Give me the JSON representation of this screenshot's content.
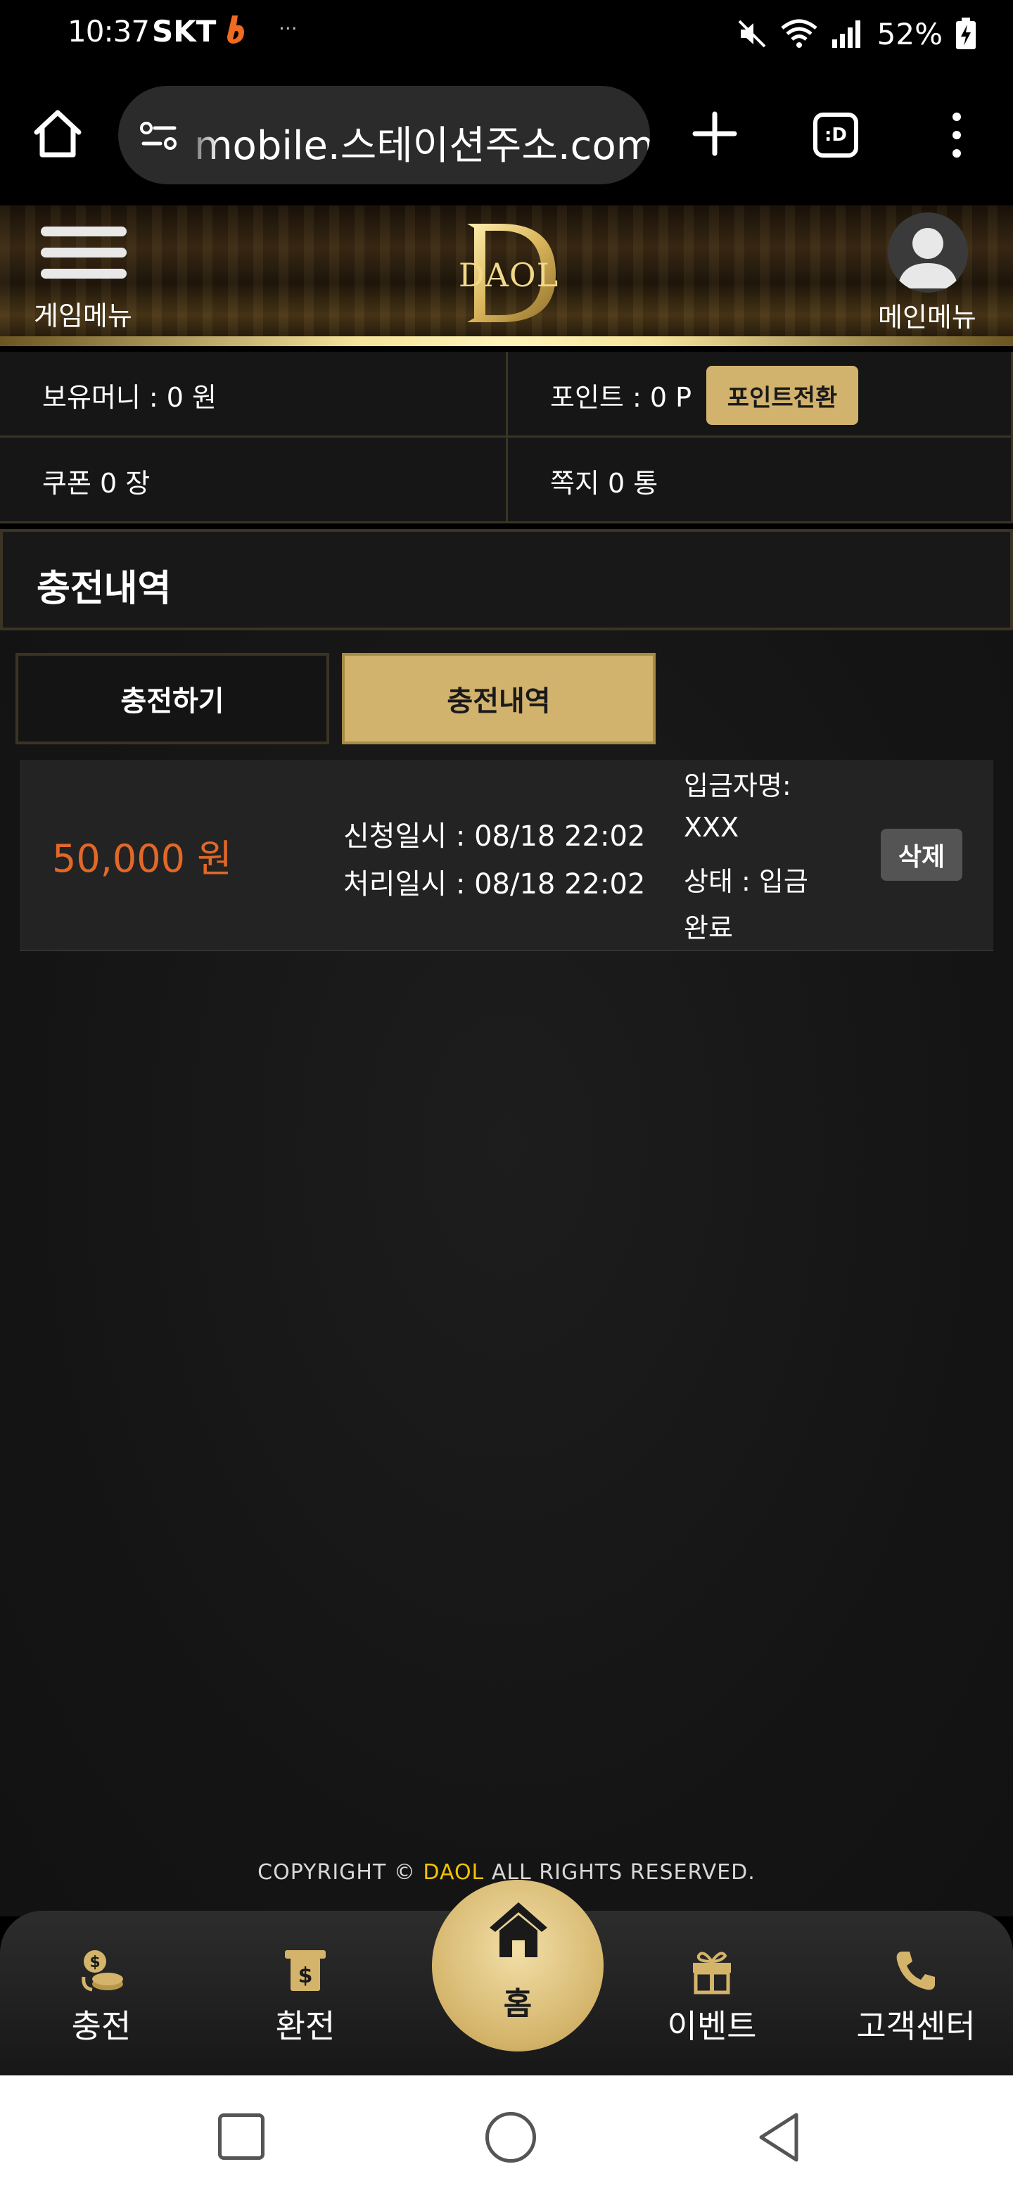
{
  "status_bar": {
    "time": "10:37",
    "carrier": "SKT",
    "more": "···",
    "battery": "52%"
  },
  "browser": {
    "url": "mobile.스테이션주소.com",
    "tabs_label": ":D"
  },
  "header": {
    "left_label": "게임메뉴",
    "logo_text": "DAOL",
    "right_label": "메인메뉴"
  },
  "account": {
    "money": "보유머니 : 0 원",
    "points": "포인트 : 0 P",
    "convert_button": "포인트전환",
    "coupons": "쿠폰 0 장",
    "messages": "쪽지 0 통"
  },
  "page": {
    "title": "충전내역"
  },
  "tabs": [
    {
      "label": "충전하기",
      "active": false
    },
    {
      "label": "충전내역",
      "active": true
    }
  ],
  "records": [
    {
      "amount": "50,000 원",
      "requested": "신청일시 : 08/18 22:02",
      "processed": "처리일시 : 08/18 22:02",
      "depositor_label": "입금자명:",
      "depositor": "XXX",
      "status_line1": "상태 : 입금",
      "status_line2": "완료",
      "delete_label": "삭제"
    }
  ],
  "footer": {
    "copyright_prefix": "COPYRIGHT © ",
    "brand": "DAOL",
    "copyright_suffix": " ALL RIGHTS RESERVED."
  },
  "bottom_nav": {
    "charge": "충전",
    "exchange": "환전",
    "home": "홈",
    "event": "이벤트",
    "support": "고객센터"
  },
  "colors": {
    "gold": "#d2b36e",
    "amount_orange": "#e26828",
    "brand_yellow": "#f2c300"
  }
}
